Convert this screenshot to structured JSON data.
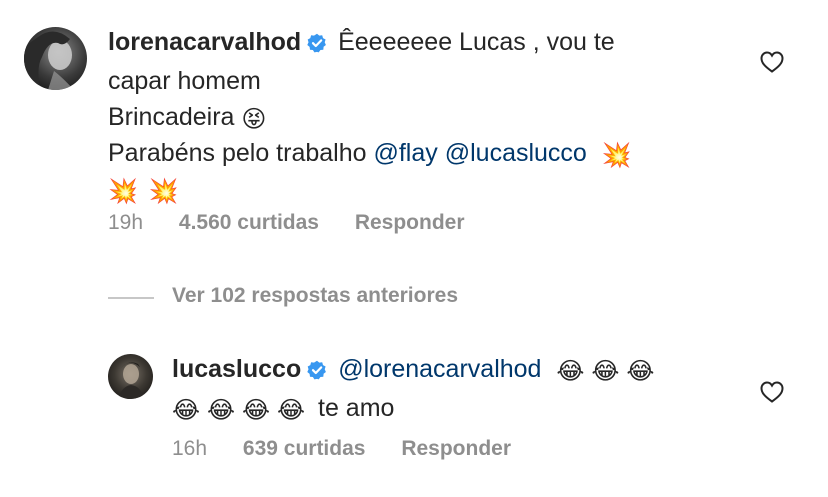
{
  "comment": {
    "username": "lorenacarvalhod",
    "line1_text": "Êeeeeeee Lucas , vou te",
    "line2_text": "capar homem",
    "line3_text": "Brincadeira",
    "line4_text": "Parabéns pelo trabalho",
    "mention1": "@flay",
    "mention2": "@lucaslucco",
    "emoji_tongue": "😝",
    "emoji_collision": "💥",
    "time": "19h",
    "likes": "4.560 curtidas",
    "reply_label": "Responder"
  },
  "view_more": {
    "label": "Ver 102 respostas anteriores"
  },
  "reply": {
    "username": "lucaslucco",
    "mention": "@lorenacarvalhod",
    "emoji_laugh": "😂",
    "text": "te amo",
    "time": "16h",
    "likes": "639 curtidas",
    "reply_label": "Responder"
  },
  "colors": {
    "verified": "#3897f0",
    "mention": "#00376b",
    "meta_text": "#8e8e8e",
    "divider": "#c7c7c7"
  }
}
